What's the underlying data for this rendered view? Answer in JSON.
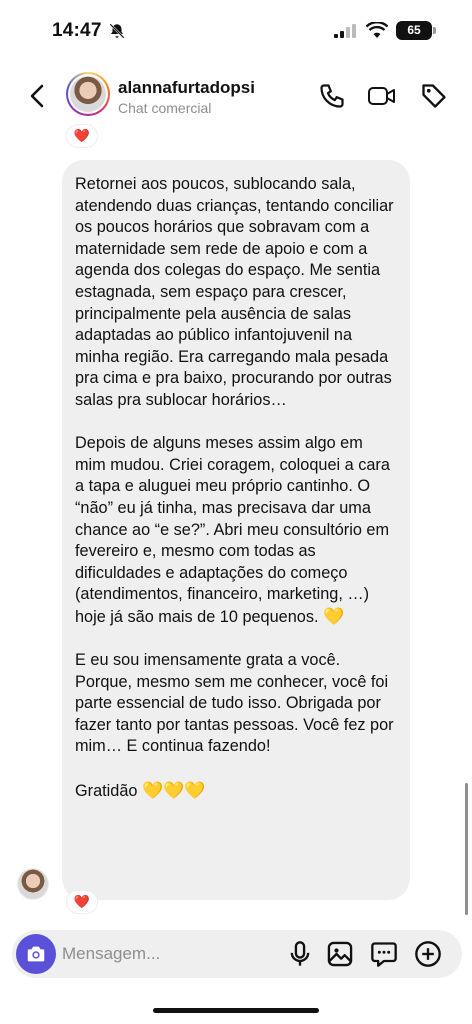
{
  "status_bar": {
    "time": "14:47",
    "battery": "65",
    "icons": [
      "bell-off-icon",
      "signal-icon",
      "wifi-icon",
      "battery-icon"
    ]
  },
  "header": {
    "username": "alannafurtadopsi",
    "subtitle": "Chat comercial",
    "icons": [
      "back-arrow-icon",
      "phone-icon",
      "video-camera-icon",
      "tag-icon"
    ]
  },
  "message": {
    "paragraphs": [
      "Retornei aos poucos, sublocando sala, atendendo duas crianças, tentando conciliar os poucos horários que sobravam com a maternidade sem rede de apoio e com a agenda dos colegas do espaço. Me sentia estagnada, sem espaço para crescer, principalmente pela ausência de salas adaptadas ao público infantojuvenil na minha região. Era carregando mala pesada pra cima e pra baixo, procurando por outras salas pra sublocar horários…",
      "Depois de alguns meses assim algo em mim mudou. Criei coragem, coloquei a cara a tapa e aluguei meu próprio cantinho. O “não” eu já tinha, mas precisava dar uma chance ao “e se?”. Abri meu consultório em fevereiro e, mesmo com todas as dificuldades e adaptações do começo (atendimentos, financeiro, marketing, …) hoje já são mais de 10 pequenos.",
      "E eu sou imensamente grata a você. Porque, mesmo sem me conhecer, você foi parte essencial de tudo isso. Obrigada por fazer tanto por tantas pessoas. Você fez por mim… E continua fazendo!",
      "Gratidão"
    ],
    "emoji_para2": "💛",
    "emoji_para4": "💛💛💛",
    "reaction": "❤️"
  },
  "composer": {
    "placeholder": "Mensagem...",
    "icons": [
      "camera-icon",
      "microphone-icon",
      "gallery-icon",
      "sticker-icon",
      "plus-icon"
    ],
    "accent_color": "#5b51d8"
  }
}
